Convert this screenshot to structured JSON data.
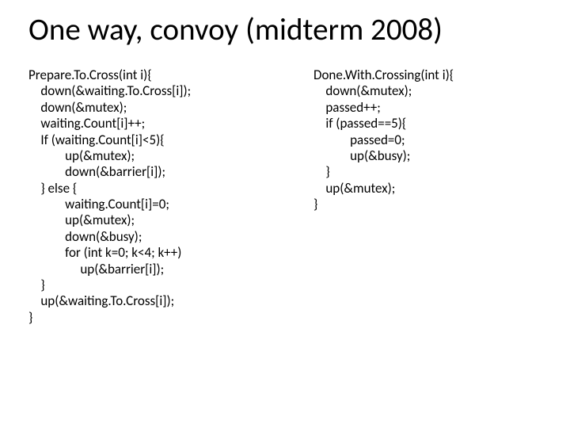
{
  "title": "One way, convoy (midterm 2008)",
  "left_code": "Prepare.To.Cross(int i){\n    down(&waiting.To.Cross[i]);\n    down(&mutex);\n    waiting.Count[i]++;\n    If (waiting.Count[i]<5){\n            up(&mutex);\n            down(&barrier[i]);\n    } else {\n            waiting.Count[i]=0;\n            up(&mutex);\n            down(&busy);\n            for (int k=0; k<4; k++)\n                 up(&barrier[i]);\n    }\n    up(&waiting.To.Cross[i]);\n}",
  "right_code": "Done.With.Crossing(int i){\n    down(&mutex);\n    passed++;\n    if (passed==5){\n            passed=0;\n            up(&busy);\n    }\n    up(&mutex);\n}"
}
